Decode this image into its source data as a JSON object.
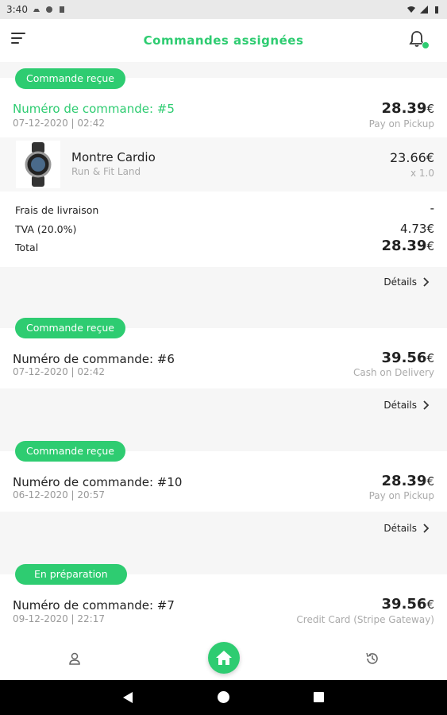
{
  "status_bar": {
    "time": "3:40"
  },
  "header": {
    "title": "Commandes assignées"
  },
  "orders": [
    {
      "badge": "Commande reçue",
      "number": "Numéro de commande: #5",
      "date": "07-12-2020 | 02:42",
      "total": "28.39",
      "currency": "€",
      "payment": "Pay on Pickup",
      "product": {
        "name": "Montre Cardio",
        "shop": "Run & Fit Land",
        "price": "23.66",
        "currency": "€",
        "qty": "x 1.0"
      },
      "summary": {
        "delivery_label": "Frais de livraison",
        "delivery_value": "-",
        "tax_label": "TVA (20.0%)",
        "tax_value": "4.73",
        "tax_currency": "€",
        "total_label": "Total",
        "total_value": "28.39",
        "total_currency": "€"
      },
      "details": "Détails"
    },
    {
      "badge": "Commande reçue",
      "number": "Numéro de commande: #6",
      "date": "07-12-2020 | 02:42",
      "total": "39.56",
      "currency": "€",
      "payment": "Cash on Delivery",
      "details": "Détails"
    },
    {
      "badge": "Commande reçue",
      "number": "Numéro de commande: #10",
      "date": "06-12-2020 | 20:57",
      "total": "28.39",
      "currency": "€",
      "payment": "Pay on Pickup",
      "details": "Détails"
    },
    {
      "badge": "En préparation",
      "number": "Numéro de commande: #7",
      "date": "09-12-2020 | 22:17",
      "total": "39.56",
      "currency": "€",
      "payment": "Credit Card (Stripe Gateway)"
    }
  ],
  "colors": {
    "accent": "#2ecc71",
    "muted": "#999999"
  },
  "bottom_nav": {
    "items": [
      "user-icon",
      "home-icon",
      "history-icon"
    ]
  }
}
